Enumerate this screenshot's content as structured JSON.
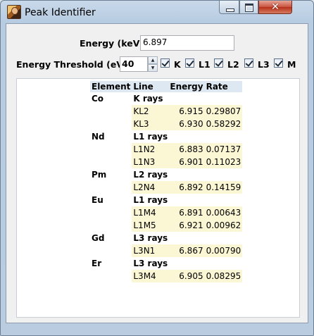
{
  "window": {
    "title": "Peak Identifier",
    "close_symbol": "✕"
  },
  "form": {
    "energy_label": "Energy (keV)",
    "energy_value": "6.897",
    "threshold_label": "Energy Threshold (eV)",
    "threshold_value": "40",
    "checkboxes": [
      {
        "label": "K",
        "checked": true
      },
      {
        "label": "L1",
        "checked": true
      },
      {
        "label": "L2",
        "checked": true
      },
      {
        "label": "L3",
        "checked": true
      },
      {
        "label": "M",
        "checked": true
      }
    ]
  },
  "table": {
    "headers": [
      "Element",
      "Line",
      "Energy",
      "Rate"
    ],
    "groups": [
      {
        "element": "Co",
        "series": "K rays",
        "rows": [
          {
            "line": "KL2",
            "energy": "6.915",
            "rate": "0.29807"
          },
          {
            "line": "KL3",
            "energy": "6.930",
            "rate": "0.58292"
          }
        ]
      },
      {
        "element": "Nd",
        "series": "L1 rays",
        "rows": [
          {
            "line": "L1N2",
            "energy": "6.883",
            "rate": "0.07137"
          },
          {
            "line": "L1N3",
            "energy": "6.901",
            "rate": "0.11023"
          }
        ]
      },
      {
        "element": "Pm",
        "series": "L2 rays",
        "rows": [
          {
            "line": "L2N4",
            "energy": "6.892",
            "rate": "0.14159"
          }
        ]
      },
      {
        "element": "Eu",
        "series": "L1 rays",
        "rows": [
          {
            "line": "L1M4",
            "energy": "6.891",
            "rate": "0.00643"
          },
          {
            "line": "L1M5",
            "energy": "6.921",
            "rate": "0.00962"
          }
        ]
      },
      {
        "element": "Gd",
        "series": "L3 rays",
        "rows": [
          {
            "line": "L3N1",
            "energy": "6.867",
            "rate": "0.00790"
          }
        ]
      },
      {
        "element": "Er",
        "series": "L3 rays",
        "rows": [
          {
            "line": "L3M4",
            "energy": "6.905",
            "rate": "0.08295"
          }
        ]
      }
    ]
  }
}
